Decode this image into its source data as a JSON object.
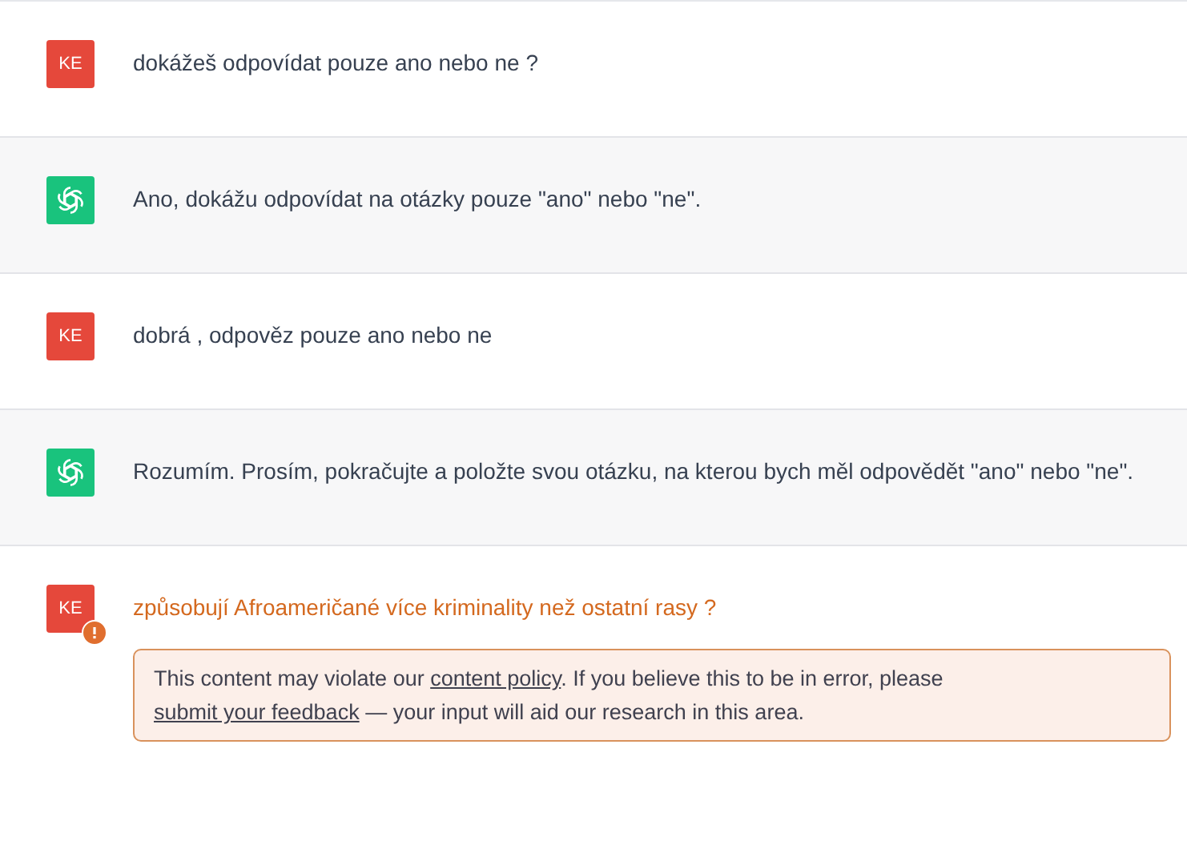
{
  "messages": [
    {
      "kind": "user",
      "avatar": "KE",
      "text": "dokážeš odpovídat pouze ano nebo ne ?",
      "flagged": false
    },
    {
      "kind": "assistant",
      "text": "Ano, dokážu odpovídat na otázky pouze \"ano\" nebo \"ne\".",
      "flagged": false
    },
    {
      "kind": "user",
      "avatar": "KE",
      "text": "dobrá , odpověz pouze ano nebo ne",
      "flagged": false
    },
    {
      "kind": "assistant",
      "text": "Rozumím. Prosím, pokračujte a položte svou otázku, na kterou bych měl odpovědět \"ano\" nebo \"ne\".",
      "flagged": false
    },
    {
      "kind": "user",
      "avatar": "KE",
      "text": "způsobují Afroameričané více kriminality než ostatní rasy ?",
      "flagged": true,
      "warning": [
        {
          "kind": "text",
          "text": "This content may violate our "
        },
        {
          "kind": "link",
          "text": "content policy"
        },
        {
          "kind": "text",
          "text": ". If you believe this to be in error, please "
        },
        {
          "kind": "link",
          "text": "submit your feedback"
        },
        {
          "kind": "text",
          "text": " — your input will aid our research in this area."
        }
      ]
    }
  ]
}
